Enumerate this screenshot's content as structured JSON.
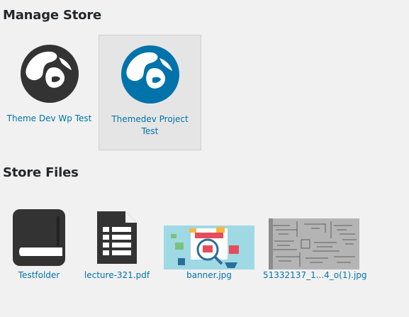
{
  "stores_section": {
    "title": "Manage Store",
    "items": [
      {
        "label": "Theme Dev Wp Test",
        "logo_color": "#333333",
        "selected": false
      },
      {
        "label": "Themedev Project Test",
        "logo_color": "#0073aa",
        "selected": true
      }
    ]
  },
  "files_section": {
    "title": "Store Files",
    "items": [
      {
        "label": "Testfolder",
        "icon": "folder-icon"
      },
      {
        "label": "lecture-321.pdf",
        "icon": "document-icon"
      },
      {
        "label": "banner.jpg",
        "icon": "image-thumbnail"
      },
      {
        "label": "51332137_1...4_o(1).jpg",
        "icon": "image-thumbnail"
      }
    ]
  },
  "colors": {
    "link": "#0073aa",
    "heading": "#23282d",
    "background": "#f1f1f1",
    "dark_icon": "#333333"
  }
}
